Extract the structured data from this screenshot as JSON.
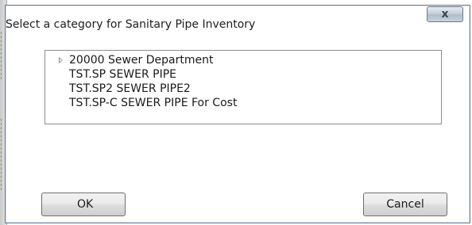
{
  "dialog": {
    "title": "Select a category for Sanitary Pipe Inventory",
    "close_label": "x"
  },
  "tree": {
    "items": [
      {
        "label": "20000 Sewer Department",
        "expandable": true
      },
      {
        "label": "TST.SP SEWER PIPE",
        "expandable": false
      },
      {
        "label": "TST.SP2 SEWER PIPE2",
        "expandable": false
      },
      {
        "label": "TST.SP-C SEWER PIPE For Cost",
        "expandable": false
      }
    ]
  },
  "buttons": {
    "ok_label": "OK",
    "cancel_label": "Cancel"
  }
}
